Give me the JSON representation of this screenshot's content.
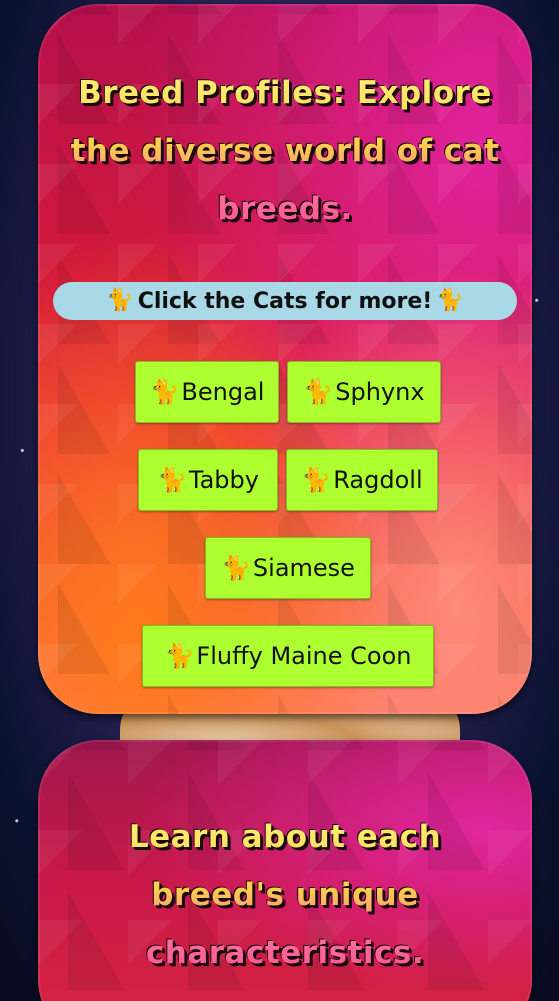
{
  "hero": {
    "title": "Breed Profiles: Explore the diverse world of cat breeds."
  },
  "banner": {
    "icon_left": "cat-icon",
    "text": "Click the Cats for more!",
    "icon_right": "cat-icon"
  },
  "breeds": [
    {
      "label": "Bengal",
      "icon": "cat-icon"
    },
    {
      "label": "Sphynx",
      "icon": "cat-icon"
    },
    {
      "label": "Tabby",
      "icon": "cat-icon"
    },
    {
      "label": "Ragdoll",
      "icon": "cat-icon"
    },
    {
      "label": "Siamese",
      "icon": "cat-icon"
    },
    {
      "label": "Fluffy Maine Coon",
      "icon": "cat-icon"
    }
  ],
  "section2": {
    "title": "Learn about each breed's unique characteristics."
  },
  "colors": {
    "button_bg": "#adff2f",
    "banner_bg": "#a9d8e6",
    "headline_fill": "#ffd24a",
    "headline_shadow": "#1a0a10"
  }
}
